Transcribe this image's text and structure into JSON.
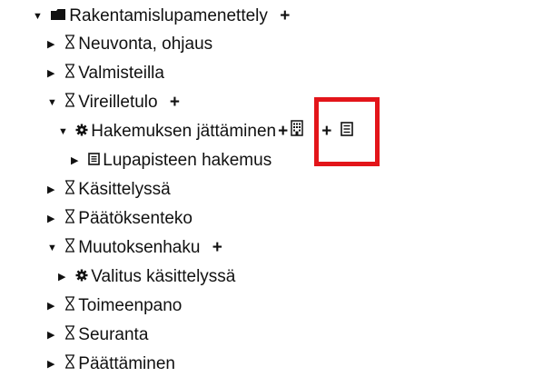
{
  "tree": {
    "root": {
      "label": "Rakentamislupamenettely",
      "icon": "folder-icon",
      "expanded": true,
      "add_label": "+"
    },
    "items": [
      {
        "label": "Neuvonta, ohjaus",
        "icon": "hourglass-icon",
        "expanded": false
      },
      {
        "label": "Valmisteilla",
        "icon": "hourglass-icon",
        "expanded": false
      },
      {
        "label": "Vireilletulo",
        "icon": "hourglass-icon",
        "expanded": true,
        "add_label": "+",
        "children": [
          {
            "label": "Hakemuksen jättäminen",
            "icon": "gear-icon",
            "expanded": true,
            "add_label": "+",
            "add2_label": "+",
            "children": [
              {
                "label": "Lupapisteen hakemus",
                "icon": "document-icon",
                "expanded": false
              }
            ]
          }
        ]
      },
      {
        "label": "Käsittelyssä",
        "icon": "hourglass-icon",
        "expanded": false
      },
      {
        "label": "Päätöksenteko",
        "icon": "hourglass-icon",
        "expanded": false
      },
      {
        "label": "Muutoksenhaku",
        "icon": "hourglass-icon",
        "expanded": true,
        "add_label": "+",
        "children": [
          {
            "label": "Valitus käsittelyssä",
            "icon": "gear-icon",
            "expanded": false
          }
        ]
      },
      {
        "label": "Toimeenpano",
        "icon": "hourglass-icon",
        "expanded": false
      },
      {
        "label": "Seuranta",
        "icon": "hourglass-icon",
        "expanded": false
      },
      {
        "label": "Päättäminen",
        "icon": "hourglass-icon",
        "expanded": false
      }
    ]
  },
  "colors": {
    "highlight": "#e3151a",
    "text": "#111111"
  }
}
